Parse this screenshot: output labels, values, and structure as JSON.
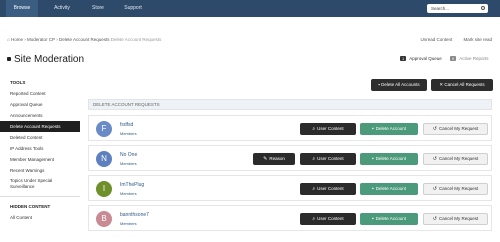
{
  "topnav": {
    "tabs": [
      {
        "label": "Browse",
        "active": true
      },
      {
        "label": "Activity",
        "active": false
      },
      {
        "label": "Store",
        "active": false
      },
      {
        "label": "Support",
        "active": false
      }
    ],
    "search_label": "Search..."
  },
  "breadcrumb": {
    "home": "Home",
    "sep": "›",
    "modcp": "Moderator CP",
    "current": "Delete Account Requests",
    "tail": "Delete Account Requests"
  },
  "toplinks": {
    "unread": "Unread Content",
    "mark_read": "Mark site read"
  },
  "page": {
    "title": "Site Moderation"
  },
  "queues": [
    {
      "count": "1",
      "label": "Approval Queue"
    },
    {
      "count": "0",
      "label": "Active Reports"
    }
  ],
  "actions": {
    "delete_all": "Delete All Accounts",
    "cancel_all": "Cancel All Requests"
  },
  "sidebar": {
    "tools_heading": "TOOLS",
    "items": [
      "Reported Content",
      "Approval Queue",
      "Announcements",
      "Delete Account Requests",
      "Deleted Content",
      "IP Address Tools",
      "Member Management",
      "Recent Warnings",
      "Topics Under Special Surveillance"
    ],
    "hidden_heading": "HIDDEN CONTENT",
    "hidden_items": [
      "All Content"
    ]
  },
  "panel": {
    "heading": "DELETE ACCOUNT REQUESTS"
  },
  "labels": {
    "reason": "Reason",
    "user_content": "User Content",
    "delete_account": "Delete Account",
    "cancel_request": "Cancel My Request"
  },
  "requests": [
    {
      "initial": "F",
      "name": "fsdfsd",
      "group": "Members",
      "avatar_color": "#6b8bc7"
    },
    {
      "initial": "N",
      "name": "No One",
      "group": "Members",
      "avatar_color": "#5f80bf"
    },
    {
      "initial": "I",
      "name": "ImThePlug",
      "group": "Members",
      "avatar_color": "#6f8f2a"
    },
    {
      "initial": "B",
      "name": "bannthsone7",
      "group": "Members",
      "avatar_color": "#c98b93"
    }
  ],
  "colors": {
    "nav": "#2d4a6b",
    "green": "#4c9a7c",
    "dark": "#2b2b2b",
    "link": "#2f5a8a"
  }
}
